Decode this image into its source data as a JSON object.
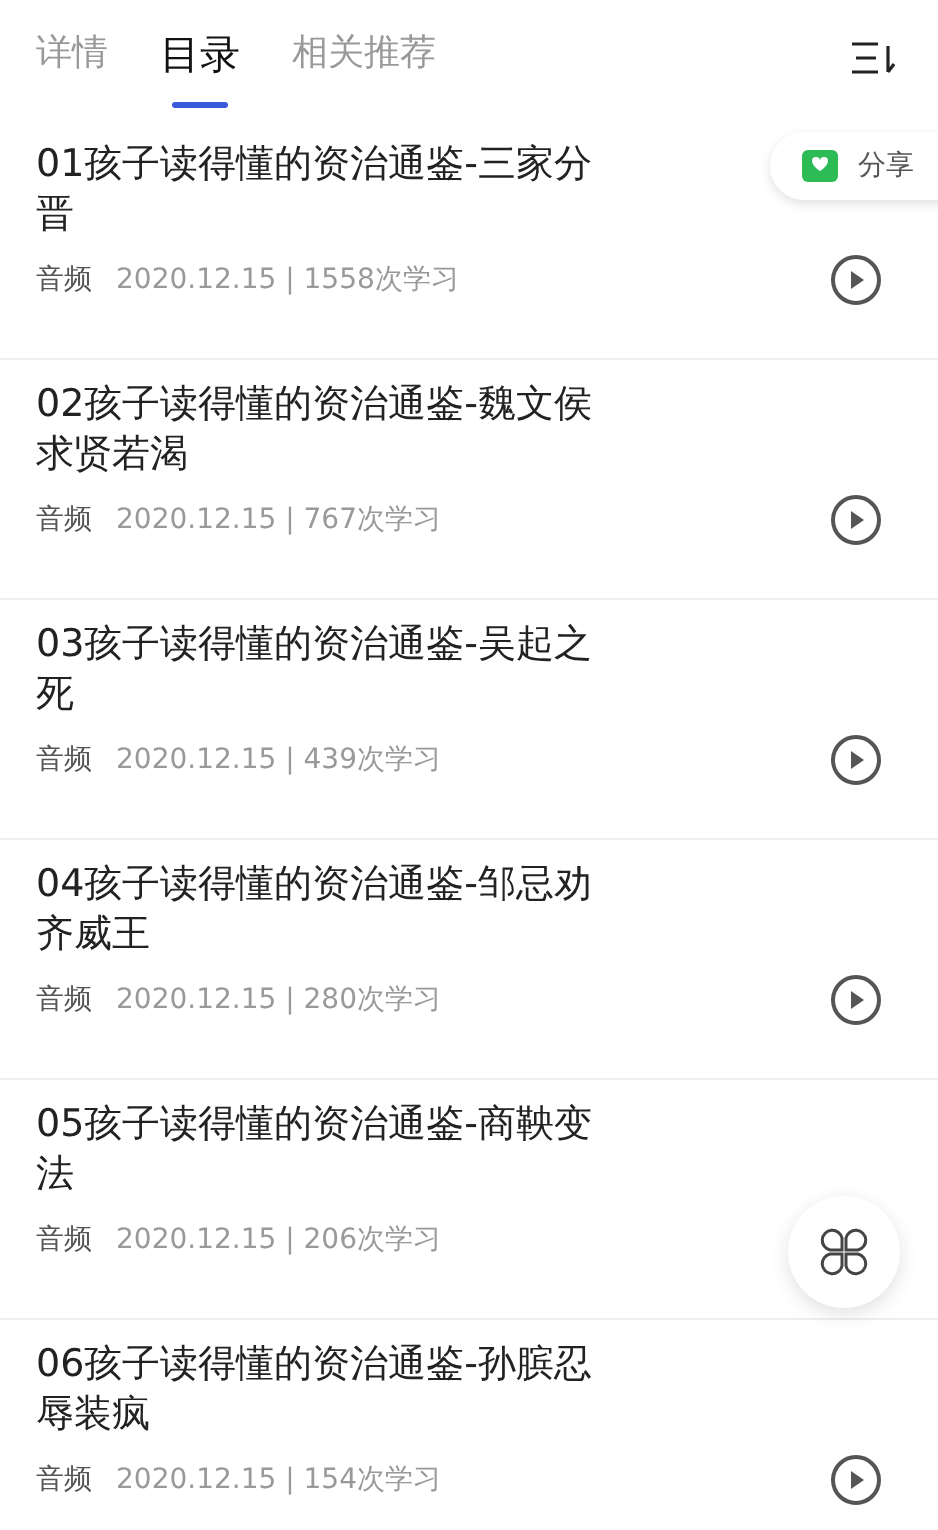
{
  "tabs": [
    {
      "label": "详情",
      "selected": false
    },
    {
      "label": "目录",
      "selected": true
    },
    {
      "label": "相关推荐",
      "selected": false
    }
  ],
  "share_button": {
    "label": "分享"
  },
  "episodes": [
    {
      "title": "01孩子读得懂的资治通鉴-三家分晋",
      "type": "音频",
      "info": "2020.12.15 | 1558次学习",
      "play_button": true
    },
    {
      "title": "02孩子读得懂的资治通鉴-魏文侯求贤若渴",
      "type": "音频",
      "info": "2020.12.15 | 767次学习",
      "play_button": true
    },
    {
      "title": "03孩子读得懂的资治通鉴-吴起之死",
      "type": "音频",
      "info": "2020.12.15 | 439次学习",
      "play_button": true
    },
    {
      "title": "04孩子读得懂的资治通鉴-邹忌劝齐威王",
      "type": "音频",
      "info": "2020.12.15 | 280次学习",
      "play_button": true
    },
    {
      "title": "05孩子读得懂的资治通鉴-商鞅变法",
      "type": "音频",
      "info": "2020.12.15 | 206次学习",
      "play_button": false
    },
    {
      "title": "06孩子读得懂的资治通鉴-孙膑忍辱装疯",
      "type": "音频",
      "info": "2020.12.15 | 154次学习",
      "play_button": true
    }
  ]
}
